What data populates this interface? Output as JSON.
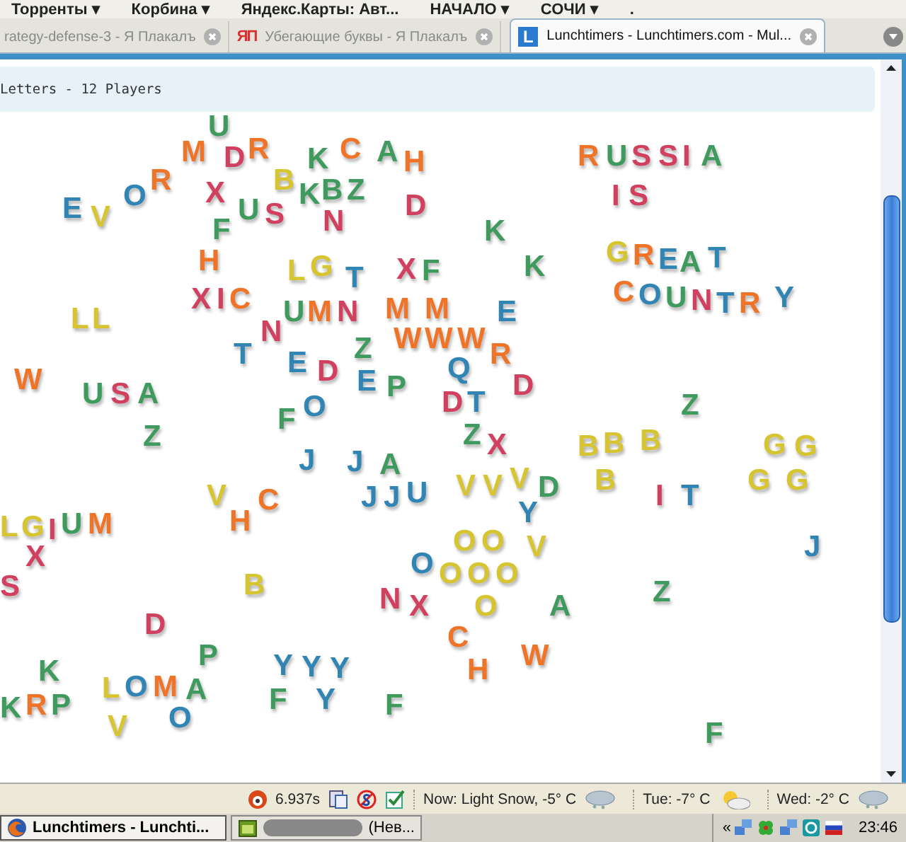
{
  "bookmarks": [
    {
      "label": "Торренты",
      "caret": "▾"
    },
    {
      "label": "Корбина",
      "caret": "▾"
    },
    {
      "label": "Яндекс.Карты: Авт..."
    },
    {
      "label": "НАЧАЛО",
      "caret": "▾"
    },
    {
      "label": "СОЧИ",
      "caret": "▾"
    },
    {
      "label": "."
    }
  ],
  "tabs": [
    {
      "title": "rategy-defense-3 - Я Плакалъ",
      "selected": false
    },
    {
      "title": "Убегающие буквы - Я Плакалъ",
      "selected": false,
      "kind": "text-logo",
      "badge": "ЯП"
    },
    {
      "title": "Lunchtimers - Lunchtimers.com - Mul...",
      "selected": true,
      "kind": "square-logo",
      "badge": "L"
    }
  ],
  "page": {
    "header": "Letters - 12 Players"
  },
  "letters": [
    {
      "char": "M",
      "color": "#f07428"
    },
    {
      "char": "U",
      "color": "#3f9a5e"
    },
    {
      "char": "R",
      "color": "#f07428"
    },
    {
      "char": "C",
      "color": "#f07428"
    },
    {
      "char": "A",
      "color": "#3f9a5e"
    },
    {
      "char": "R",
      "color": "#f07428"
    },
    {
      "char": "D",
      "color": "#d2405f"
    },
    {
      "char": "B",
      "color": "#d6c431"
    },
    {
      "char": "K",
      "color": "#3f9a5e"
    },
    {
      "char": "H",
      "color": "#f07428"
    },
    {
      "char": "R",
      "color": "#f07428"
    },
    {
      "char": "U",
      "color": "#3f9a5e"
    },
    {
      "char": "S",
      "color": "#d2405f"
    },
    {
      "char": "S",
      "color": "#d2405f"
    },
    {
      "char": "I",
      "color": "#d2405f"
    },
    {
      "char": "A",
      "color": "#3f9a5e"
    },
    {
      "char": "E",
      "color": "#3185b5"
    },
    {
      "char": "O",
      "color": "#3185b5"
    },
    {
      "char": "X",
      "color": "#d2405f"
    },
    {
      "char": "K",
      "color": "#3f9a5e"
    },
    {
      "char": "B",
      "color": "#3f9a5e"
    },
    {
      "char": "Z",
      "color": "#3f9a5e"
    },
    {
      "char": "D",
      "color": "#d2405f"
    },
    {
      "char": "I",
      "color": "#d2405f"
    },
    {
      "char": "S",
      "color": "#d2405f"
    },
    {
      "char": "V",
      "color": "#d6c431"
    },
    {
      "char": "F",
      "color": "#3f9a5e"
    },
    {
      "char": "U",
      "color": "#3f9a5e"
    },
    {
      "char": "S",
      "color": "#d2405f"
    },
    {
      "char": "N",
      "color": "#d2405f"
    },
    {
      "char": "K",
      "color": "#3f9a5e"
    },
    {
      "char": "H",
      "color": "#f07428"
    },
    {
      "char": "G",
      "color": "#d6c431"
    },
    {
      "char": "R",
      "color": "#f07428"
    },
    {
      "char": "E",
      "color": "#3185b5"
    },
    {
      "char": "A",
      "color": "#3f9a5e"
    },
    {
      "char": "T",
      "color": "#3185b5"
    },
    {
      "char": "L",
      "color": "#d6c431"
    },
    {
      "char": "G",
      "color": "#d6c431"
    },
    {
      "char": "T",
      "color": "#3185b5"
    },
    {
      "char": "X",
      "color": "#d2405f"
    },
    {
      "char": "F",
      "color": "#3f9a5e"
    },
    {
      "char": "K",
      "color": "#3f9a5e"
    },
    {
      "char": "C",
      "color": "#f07428"
    },
    {
      "char": "O",
      "color": "#3185b5"
    },
    {
      "char": "U",
      "color": "#3f9a5e"
    },
    {
      "char": "N",
      "color": "#d2405f"
    },
    {
      "char": "T",
      "color": "#3185b5"
    },
    {
      "char": "R",
      "color": "#f07428"
    },
    {
      "char": "Y",
      "color": "#3185b5"
    },
    {
      "char": "L",
      "color": "#d6c431"
    },
    {
      "char": "L",
      "color": "#d6c431"
    },
    {
      "char": "X",
      "color": "#d2405f"
    },
    {
      "char": "I",
      "color": "#d2405f"
    },
    {
      "char": "C",
      "color": "#f07428"
    },
    {
      "char": "U",
      "color": "#3f9a5e"
    },
    {
      "char": "M",
      "color": "#f07428"
    },
    {
      "char": "N",
      "color": "#d2405f"
    },
    {
      "char": "M",
      "color": "#f07428"
    },
    {
      "char": "M",
      "color": "#f07428"
    },
    {
      "char": "E",
      "color": "#3185b5"
    },
    {
      "char": "N",
      "color": "#d2405f"
    },
    {
      "char": "Z",
      "color": "#3f9a5e"
    },
    {
      "char": "W",
      "color": "#f07428"
    },
    {
      "char": "W",
      "color": "#f07428"
    },
    {
      "char": "W",
      "color": "#f07428"
    },
    {
      "char": "T",
      "color": "#3185b5"
    },
    {
      "char": "E",
      "color": "#3185b5"
    },
    {
      "char": "D",
      "color": "#d2405f"
    },
    {
      "char": "Q",
      "color": "#3185b5"
    },
    {
      "char": "R",
      "color": "#f07428"
    },
    {
      "char": "W",
      "color": "#f07428"
    },
    {
      "char": "U",
      "color": "#3f9a5e"
    },
    {
      "char": "S",
      "color": "#d2405f"
    },
    {
      "char": "A",
      "color": "#3f9a5e"
    },
    {
      "char": "O",
      "color": "#3185b5"
    },
    {
      "char": "E",
      "color": "#3185b5"
    },
    {
      "char": "P",
      "color": "#3f9a5e"
    },
    {
      "char": "D",
      "color": "#d2405f"
    },
    {
      "char": "T",
      "color": "#3185b5"
    },
    {
      "char": "D",
      "color": "#d2405f"
    },
    {
      "char": "Z",
      "color": "#3f9a5e"
    },
    {
      "char": "Z",
      "color": "#3f9a5e"
    },
    {
      "char": "F",
      "color": "#3f9a5e"
    },
    {
      "char": "Z",
      "color": "#3f9a5e"
    },
    {
      "char": "J",
      "color": "#3185b5"
    },
    {
      "char": "J",
      "color": "#3185b5"
    },
    {
      "char": "X",
      "color": "#d2405f"
    },
    {
      "char": "B",
      "color": "#d6c431"
    },
    {
      "char": "B",
      "color": "#d6c431"
    },
    {
      "char": "B",
      "color": "#d6c431"
    },
    {
      "char": "G",
      "color": "#d6c431"
    },
    {
      "char": "G",
      "color": "#d6c431"
    },
    {
      "char": "A",
      "color": "#3f9a5e"
    },
    {
      "char": "V",
      "color": "#d6c431"
    },
    {
      "char": "V",
      "color": "#d6c431"
    },
    {
      "char": "V",
      "color": "#d6c431"
    },
    {
      "char": "D",
      "color": "#3f9a5e"
    },
    {
      "char": "B",
      "color": "#d6c431"
    },
    {
      "char": "G",
      "color": "#d6c431"
    },
    {
      "char": "G",
      "color": "#d6c431"
    },
    {
      "char": "V",
      "color": "#d6c431"
    },
    {
      "char": "C",
      "color": "#f07428"
    },
    {
      "char": "J",
      "color": "#3185b5"
    },
    {
      "char": "J",
      "color": "#3185b5"
    },
    {
      "char": "U",
      "color": "#3185b5"
    },
    {
      "char": "Y",
      "color": "#3185b5"
    },
    {
      "char": "I",
      "color": "#d2405f"
    },
    {
      "char": "T",
      "color": "#3185b5"
    },
    {
      "char": "L",
      "color": "#d6c431"
    },
    {
      "char": "G",
      "color": "#d6c431"
    },
    {
      "char": "I",
      "color": "#d2405f"
    },
    {
      "char": "U",
      "color": "#3f9a5e"
    },
    {
      "char": "M",
      "color": "#f07428"
    },
    {
      "char": "H",
      "color": "#f07428"
    },
    {
      "char": "O",
      "color": "#d6c431"
    },
    {
      "char": "O",
      "color": "#d6c431"
    },
    {
      "char": "V",
      "color": "#d6c431"
    },
    {
      "char": "J",
      "color": "#3185b5"
    },
    {
      "char": "X",
      "color": "#d2405f"
    },
    {
      "char": "O",
      "color": "#3185b5"
    },
    {
      "char": "O",
      "color": "#d6c431"
    },
    {
      "char": "O",
      "color": "#d6c431"
    },
    {
      "char": "O",
      "color": "#d6c431"
    },
    {
      "char": "S",
      "color": "#d2405f"
    },
    {
      "char": "B",
      "color": "#d6c431"
    },
    {
      "char": "N",
      "color": "#d2405f"
    },
    {
      "char": "Z",
      "color": "#3f9a5e"
    },
    {
      "char": "D",
      "color": "#d2405f"
    },
    {
      "char": "X",
      "color": "#d2405f"
    },
    {
      "char": "O",
      "color": "#d6c431"
    },
    {
      "char": "A",
      "color": "#3f9a5e"
    },
    {
      "char": "P",
      "color": "#3f9a5e"
    },
    {
      "char": "C",
      "color": "#f07428"
    },
    {
      "char": "W",
      "color": "#f07428"
    },
    {
      "char": "K",
      "color": "#3f9a5e"
    },
    {
      "char": "L",
      "color": "#d6c431"
    },
    {
      "char": "O",
      "color": "#3185b5"
    },
    {
      "char": "M",
      "color": "#f07428"
    },
    {
      "char": "A",
      "color": "#3f9a5e"
    },
    {
      "char": "Y",
      "color": "#3185b5"
    },
    {
      "char": "Y",
      "color": "#3185b5"
    },
    {
      "char": "Y",
      "color": "#3185b5"
    },
    {
      "char": "H",
      "color": "#f07428"
    },
    {
      "char": "K",
      "color": "#3f9a5e"
    },
    {
      "char": "R",
      "color": "#f07428"
    },
    {
      "char": "P",
      "color": "#3f9a5e"
    },
    {
      "char": "O",
      "color": "#3185b5"
    },
    {
      "char": "F",
      "color": "#3f9a5e"
    },
    {
      "char": "Y",
      "color": "#3185b5"
    },
    {
      "char": "F",
      "color": "#3f9a5e"
    },
    {
      "char": "V",
      "color": "#d6c431"
    },
    {
      "char": "F",
      "color": "#3f9a5e"
    }
  ],
  "status_bar": {
    "timer": "6.937s",
    "weather": [
      {
        "text": "Now: Light Snow, -5° C",
        "kind": "snow"
      },
      {
        "text": "Tue: -7° C",
        "kind": "sun"
      },
      {
        "text": "Wed: -2° C",
        "kind": "snow"
      }
    ]
  },
  "taskbar": {
    "buttons": [
      {
        "title": "Lunchtimers - Lunchti...",
        "selected": true,
        "kind": "browser"
      },
      {
        "title": "(Нев...",
        "selected": false,
        "kind": "app",
        "redacted": true
      }
    ],
    "tray_toggle": "«",
    "clock": "23:46"
  }
}
